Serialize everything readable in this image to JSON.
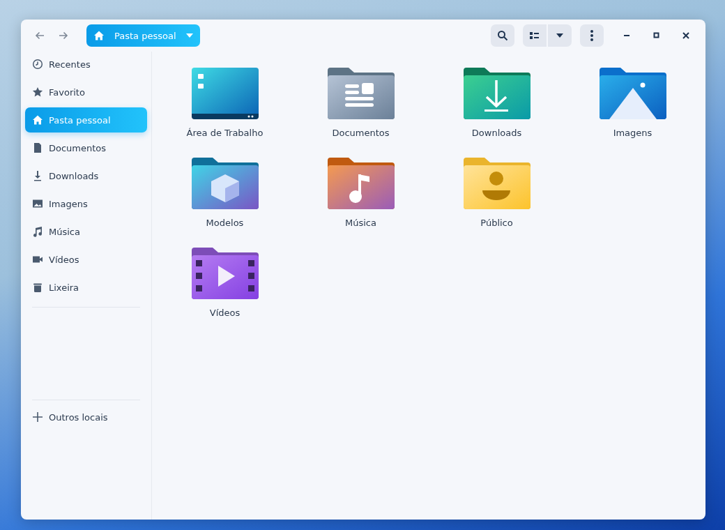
{
  "header": {
    "location": {
      "label": "Pasta pessoal"
    }
  },
  "sidebar": {
    "items": [
      {
        "kind": "recent",
        "label": "Recentes",
        "selected": false
      },
      {
        "kind": "star",
        "label": "Favorito",
        "selected": false
      },
      {
        "kind": "home",
        "label": "Pasta pessoal",
        "selected": true
      },
      {
        "kind": "document",
        "label": "Documentos",
        "selected": false
      },
      {
        "kind": "download",
        "label": "Downloads",
        "selected": false
      },
      {
        "kind": "image",
        "label": "Imagens",
        "selected": false
      },
      {
        "kind": "music",
        "label": "Música",
        "selected": false
      },
      {
        "kind": "video",
        "label": "Vídeos",
        "selected": false
      },
      {
        "kind": "trash",
        "label": "Lixeira",
        "selected": false
      }
    ],
    "other": {
      "label": "Outros locais"
    }
  },
  "folder_rows": [
    [
      {
        "kind": "desktop",
        "label": "Área de Trabalho"
      },
      {
        "kind": "documents",
        "label": "Documentos"
      },
      {
        "kind": "downloads",
        "label": "Downloads"
      },
      {
        "kind": "pictures",
        "label": "Imagens"
      }
    ],
    [
      {
        "kind": "templates",
        "label": "Modelos"
      },
      {
        "kind": "music",
        "label": "Música"
      },
      {
        "kind": "public",
        "label": "Público"
      }
    ],
    [
      {
        "kind": "videos",
        "label": "Vídeos"
      }
    ]
  ]
}
